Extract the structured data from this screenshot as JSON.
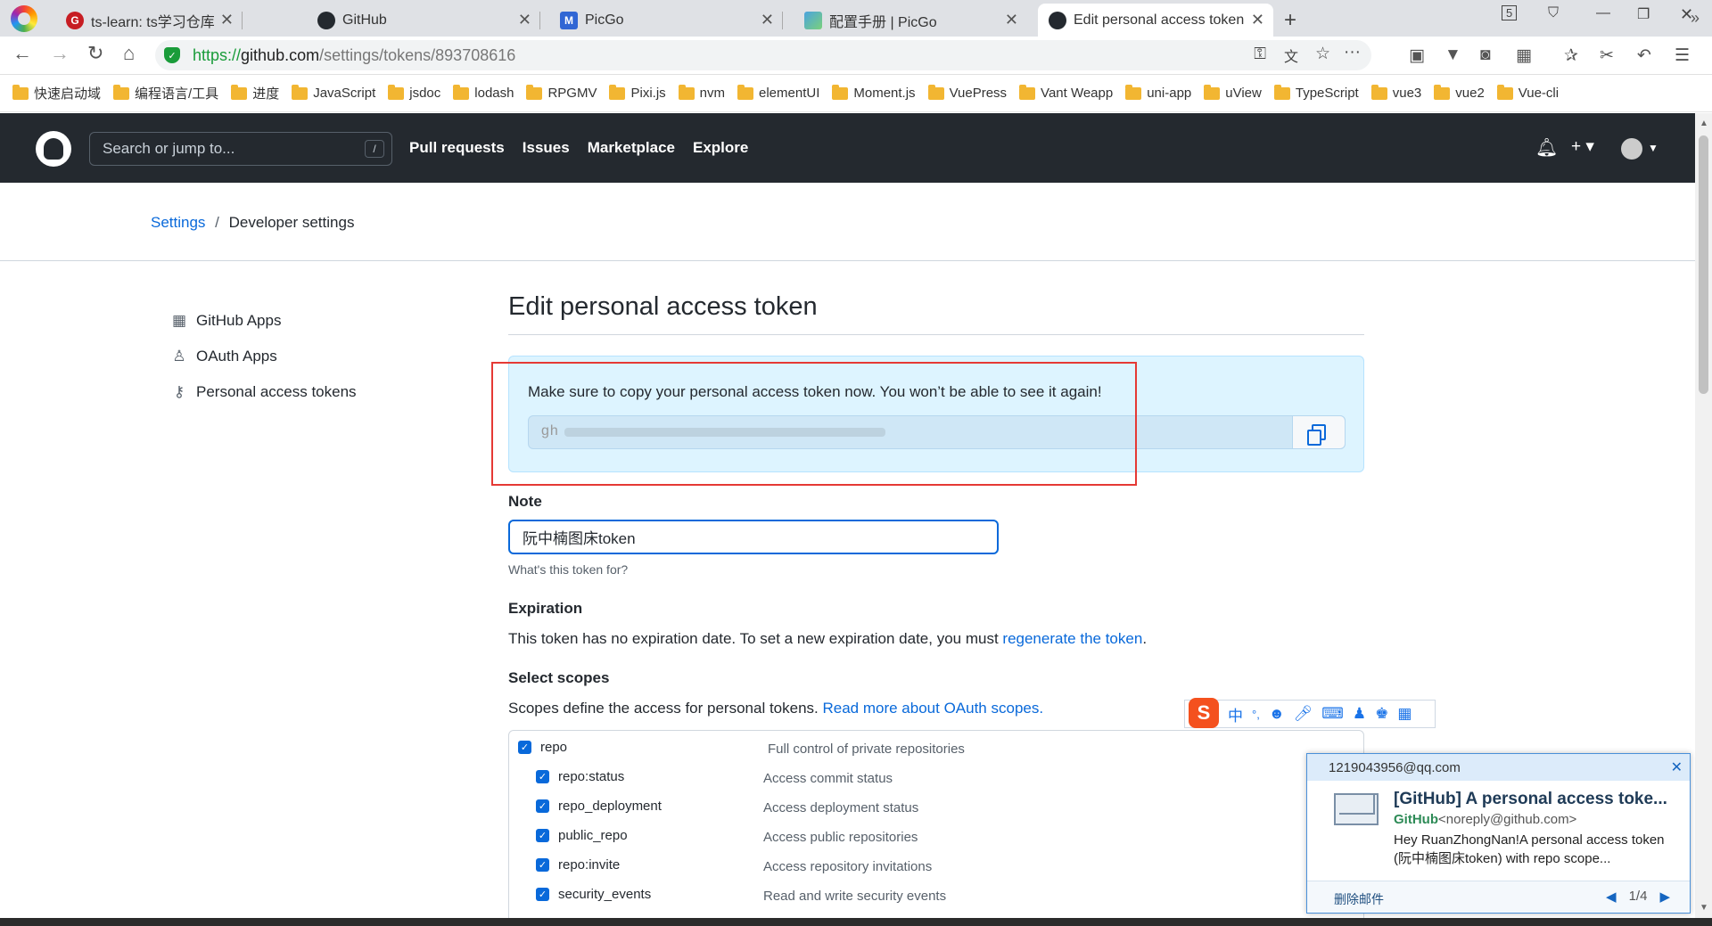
{
  "browser": {
    "tabs": [
      {
        "label": "ts-learn: ts学习仓库",
        "icon": "gitee-icon"
      },
      {
        "label": "GitHub",
        "icon": "github-icon"
      },
      {
        "label": "PicGo",
        "icon": "picgo-icon"
      },
      {
        "label": "配置手册 | PicGo",
        "icon": "picgo-docs-icon"
      },
      {
        "label": "Edit personal access token",
        "icon": "github-icon",
        "active": true
      }
    ],
    "new_tab": "+",
    "tab_count": "5",
    "url": {
      "scheme": "https://",
      "host": "github.com",
      "path": "/settings/tokens/893708616"
    },
    "bookmarks": [
      "快速启动域",
      "编程语言/工具",
      "进度",
      "JavaScript",
      "jsdoc",
      "lodash",
      "RPGMV",
      "Pixi.js",
      "nvm",
      "elementUI",
      "Moment.js",
      "VuePress",
      "Vant Weapp",
      "uni-app",
      "uView",
      "TypeScript",
      "vue3",
      "vue2",
      "Vue-cli"
    ],
    "bookmarks_more": "»"
  },
  "github": {
    "search_placeholder": "Search or jump to...",
    "search_key": "/",
    "nav": [
      "Pull requests",
      "Issues",
      "Marketplace",
      "Explore"
    ],
    "plus": "+ ▾"
  },
  "breadcrumb": {
    "root": "Settings",
    "sep": "/",
    "current": "Developer settings"
  },
  "sidebar": [
    {
      "label": "GitHub Apps",
      "icon": "apps-grid-icon"
    },
    {
      "label": "OAuth Apps",
      "icon": "person-icon"
    },
    {
      "label": "Personal access tokens",
      "icon": "key-icon"
    }
  ],
  "main": {
    "title": "Edit personal access token",
    "flash": "Make sure to copy your personal access token now. You won’t be able to see it again!",
    "token_prefix": "gh",
    "note_label": "Note",
    "note_value": "阮中楠图床token",
    "note_hint": "What's this token for?",
    "expiration_label": "Expiration",
    "expiration_text": "This token has no expiration date. To set a new expiration date, you must ",
    "expiration_link": "regenerate the token",
    "expiration_end": ".",
    "scopes_label": "Select scopes",
    "scopes_text": "Scopes define the access for personal tokens. ",
    "scopes_link": "Read more about OAuth scopes.",
    "scopes": [
      {
        "name": "repo",
        "desc": "Full control of private repositories",
        "checked": true
      },
      {
        "name": "repo:status",
        "desc": "Access commit status",
        "checked": true
      },
      {
        "name": "repo_deployment",
        "desc": "Access deployment status",
        "checked": true
      },
      {
        "name": "public_repo",
        "desc": "Access public repositories",
        "checked": true
      },
      {
        "name": "repo:invite",
        "desc": "Access repository invitations",
        "checked": true
      },
      {
        "name": "security_events",
        "desc": "Read and write security events",
        "checked": true
      }
    ]
  },
  "ime": {
    "logo": "S",
    "mode": "中",
    "punct": "°,"
  },
  "mail": {
    "account": "1219043956@qq.com",
    "subject": "[GitHub] A personal access toke...",
    "from_name": "GitHub",
    "from_addr": "<noreply@github.com>",
    "body": "Hey RuanZhongNan!A personal access token (阮中楠图床token) with repo scope...",
    "delete": "删除邮件",
    "pager": "1/4"
  },
  "colors": {
    "accent": "#0969da",
    "header": "#24292f",
    "flash_bg": "#ddf4ff",
    "highlight": "#e53935"
  }
}
